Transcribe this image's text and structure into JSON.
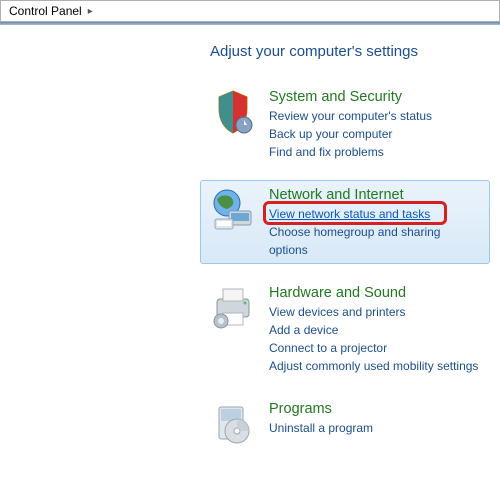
{
  "addressbar": {
    "crumb1": "Control Panel"
  },
  "page": {
    "title": "Adjust your computer's settings"
  },
  "cats": {
    "sys": {
      "head": "System and Security",
      "tasks": [
        "Review your computer's status",
        "Back up your computer",
        "Find and fix problems"
      ]
    },
    "net": {
      "head": "Network and Internet",
      "tasks": [
        "View network status and tasks",
        "Choose homegroup and sharing options"
      ]
    },
    "hw": {
      "head": "Hardware and Sound",
      "tasks": [
        "View devices and printers",
        "Add a device",
        "Connect to a projector",
        "Adjust commonly used mobility settings"
      ]
    },
    "prog": {
      "head": "Programs",
      "tasks": [
        "Uninstall a program"
      ]
    }
  }
}
